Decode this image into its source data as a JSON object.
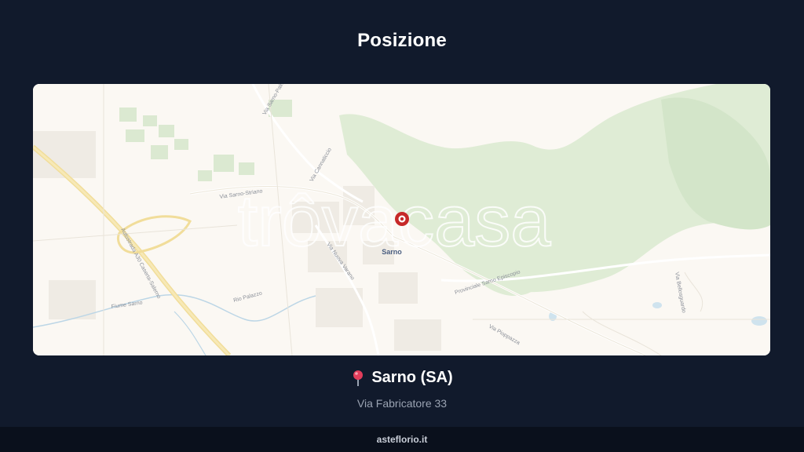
{
  "header": {
    "title": "Posizione"
  },
  "map": {
    "watermark": "trôvacasa",
    "city_label": "Sarno",
    "street_labels": [
      "Via Sarno-Palma",
      "Via Cannaticcio",
      "Via Sarno-Striano",
      "Via Nuova Varano",
      "Via Pioppazza",
      "Autostrada A30 Caserta-Salerno",
      "Provinciale Sarno Episcopio",
      "Rio Palazzo",
      "Fiume Sarno",
      "Via Bellosguardo"
    ],
    "marker_color": "#c62828"
  },
  "location": {
    "pin_icon": "round-pushpin-icon",
    "city": "Sarno (SA)",
    "address": "Via Fabricatore 33"
  },
  "footer": {
    "site": "asteflorio.it"
  }
}
